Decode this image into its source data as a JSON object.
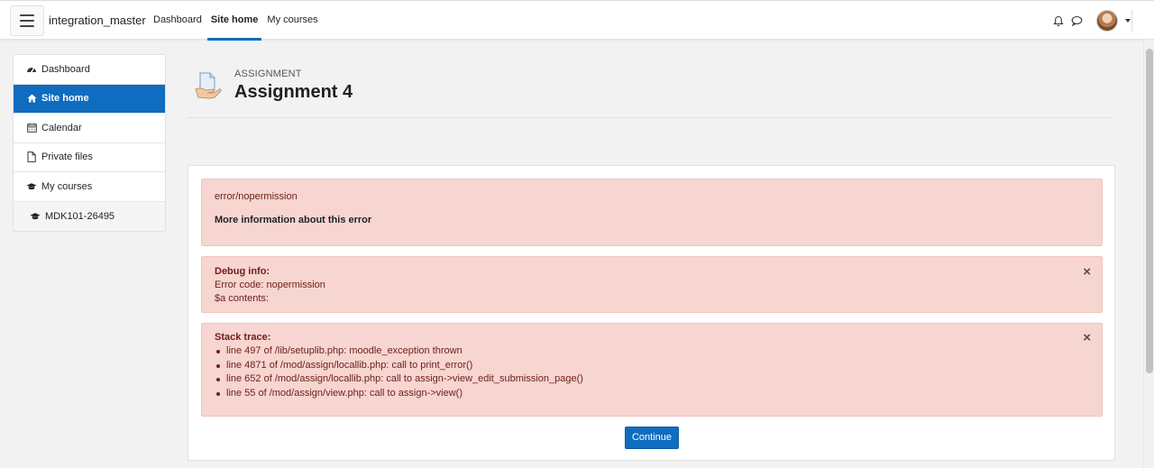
{
  "navbar": {
    "brand": "integration_master",
    "links": [
      "Dashboard",
      "Site home",
      "My courses"
    ],
    "active_link": "Site home"
  },
  "sidebar": {
    "items": [
      {
        "label": "Dashboard",
        "icon": "dashboard-icon"
      },
      {
        "label": "Site home",
        "icon": "home-icon",
        "active": true
      },
      {
        "label": "Calendar",
        "icon": "calendar-icon"
      },
      {
        "label": "Private files",
        "icon": "file-icon"
      },
      {
        "label": "My courses",
        "icon": "graduation-cap-icon"
      },
      {
        "label": "MDK101-26495",
        "icon": "graduation-cap-icon"
      }
    ]
  },
  "header": {
    "pre_title": "ASSIGNMENT",
    "title": "Assignment 4"
  },
  "error": {
    "message": "error/nopermission",
    "more_info": "More information about this error"
  },
  "debug": {
    "heading": "Debug info:",
    "error_code": "Error code: nopermission",
    "contents": "$a contents:"
  },
  "stack": {
    "heading": "Stack trace:",
    "lines": [
      "line 497 of /lib/setuplib.php: moodle_exception thrown",
      "line 4871 of /mod/assign/locallib.php: call to print_error()",
      "line 652 of /mod/assign/locallib.php: call to assign->view_edit_submission_page()",
      "line 55 of /mod/assign/view.php: call to assign->view()"
    ]
  },
  "close_glyph": "×",
  "continue_label": "Continue",
  "colors": {
    "primary": "#0f6cbf",
    "alert_bg": "#f7d5d1",
    "alert_text": "#6e211a"
  }
}
